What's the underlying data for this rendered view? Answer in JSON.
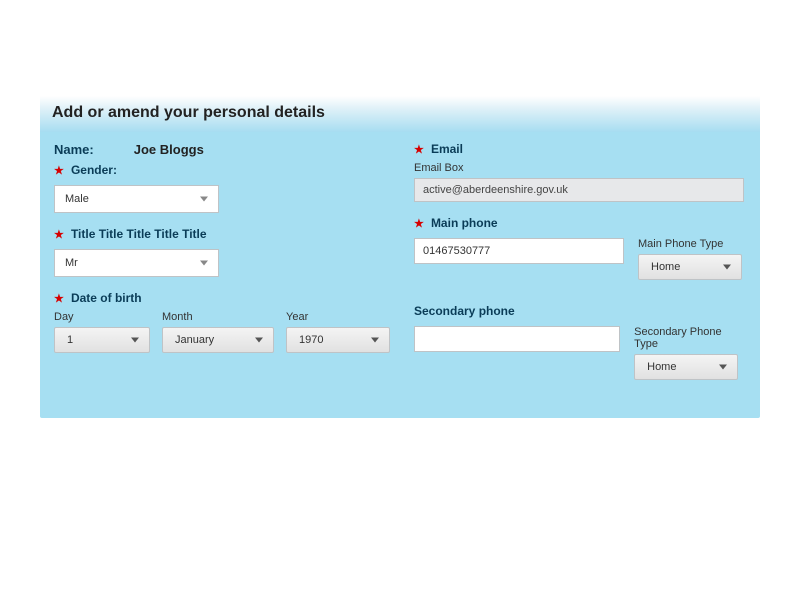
{
  "header": {
    "title": "Add or amend your personal details"
  },
  "left": {
    "name_label": "Name:",
    "name_value": "Joe Bloggs",
    "gender_label": "Gender:",
    "gender_value": "Male",
    "title_label": "Title Title Title Title Title",
    "title_value": "Mr",
    "dob_label": "Date of birth",
    "dob_day_label": "Day",
    "dob_day_value": "1",
    "dob_month_label": "Month",
    "dob_month_value": "January",
    "dob_year_label": "Year",
    "dob_year_value": "1970"
  },
  "right": {
    "email_label": "Email",
    "email_box_label": "Email Box",
    "email_value": "active@aberdeenshire.gov.uk",
    "main_phone_label": "Main phone",
    "main_phone_value": "01467530777",
    "main_phone_type_label": "Main Phone Type",
    "main_phone_type_value": "Home",
    "secondary_phone_label": "Secondary phone",
    "secondary_phone_value": "",
    "secondary_phone_type_label": "Secondary Phone Type",
    "secondary_phone_type_value": "Home"
  }
}
